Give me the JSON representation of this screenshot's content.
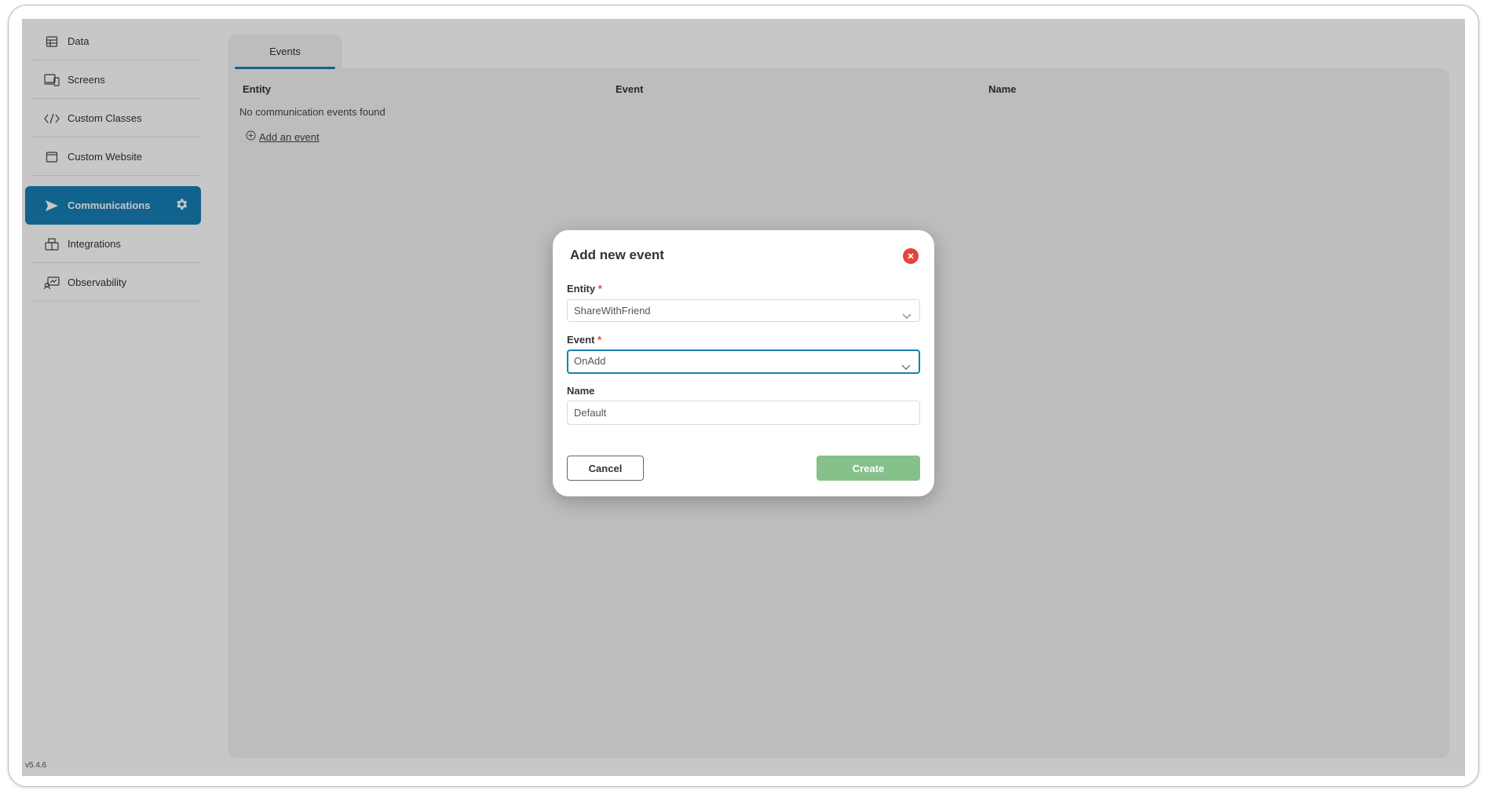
{
  "sidebar": {
    "items": [
      {
        "label": "Data",
        "icon": "table-icon"
      },
      {
        "label": "Screens",
        "icon": "screens-icon"
      },
      {
        "label": "Custom Classes",
        "icon": "code-icon"
      },
      {
        "label": "Custom Website",
        "icon": "browser-icon"
      },
      {
        "label": "Communications",
        "icon": "send-icon",
        "active": true
      },
      {
        "label": "Integrations",
        "icon": "integrations-icon"
      },
      {
        "label": "Observability",
        "icon": "observability-icon"
      }
    ],
    "version": "v5.4.6"
  },
  "main": {
    "tab_label": "Events",
    "columns": [
      "Entity",
      "Event",
      "Name"
    ],
    "empty_text": "No communication events found",
    "add_event_label": "Add an event"
  },
  "modal": {
    "title": "Add new event",
    "entity": {
      "label": "Entity",
      "required_mark": "*",
      "value": "ShareWithFriend"
    },
    "event": {
      "label": "Event",
      "required_mark": "*",
      "value": "OnAdd"
    },
    "name": {
      "label": "Name",
      "value": "Default"
    },
    "cancel_label": "Cancel",
    "create_label": "Create"
  },
  "colors": {
    "accent": "#167fb5",
    "create_button": "#86c08b",
    "close_button": "#e5443a"
  }
}
